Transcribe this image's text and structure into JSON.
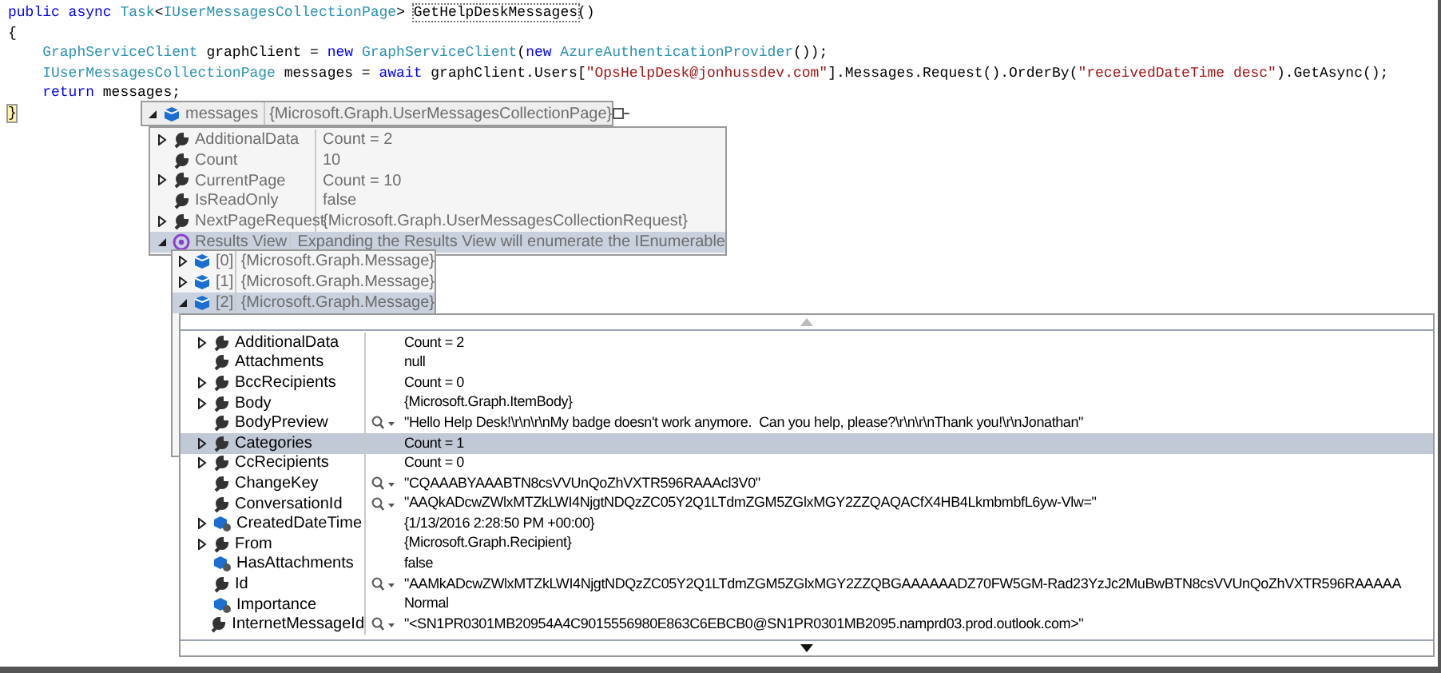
{
  "code_lines": [
    {
      "indented": false,
      "tokens": [
        {
          "text": "public async ",
          "kind": "keyword"
        },
        {
          "text": "Task",
          "kind": "type"
        },
        {
          "text": "<",
          "kind": "plain"
        },
        {
          "text": "IUserMessagesCollectionPage",
          "kind": "type"
        },
        {
          "text": "> ",
          "kind": "plain"
        },
        {
          "text": "GetHelpDeskMessages",
          "kind": "highlight"
        },
        {
          "text": "()",
          "kind": "plain"
        }
      ]
    },
    {
      "indented": false,
      "tokens": [
        {
          "text": "{",
          "kind": "plain"
        }
      ]
    },
    {
      "indented": true,
      "tokens": [
        {
          "text": "GraphServiceClient",
          "kind": "type"
        },
        {
          "text": " graphClient = ",
          "kind": "plain"
        },
        {
          "text": "new ",
          "kind": "keyword"
        },
        {
          "text": "GraphServiceClient",
          "kind": "type"
        },
        {
          "text": "(",
          "kind": "plain"
        },
        {
          "text": "new ",
          "kind": "keyword"
        },
        {
          "text": "AzureAuthenticationProvider",
          "kind": "type"
        },
        {
          "text": "());",
          "kind": "plain"
        }
      ]
    },
    {
      "indented": true,
      "tokens": [
        {
          "text": "IUserMessagesCollectionPage",
          "kind": "type"
        },
        {
          "text": " messages = ",
          "kind": "plain"
        },
        {
          "text": "await ",
          "kind": "keyword"
        },
        {
          "text": "graphClient.Users[",
          "kind": "plain"
        },
        {
          "text": "\"OpsHelpDesk@jonhussdev.com\"",
          "kind": "string"
        },
        {
          "text": "].Messages.Request().OrderBy(",
          "kind": "plain"
        },
        {
          "text": "\"receivedDateTime desc\"",
          "kind": "string"
        },
        {
          "text": ").GetAsync();",
          "kind": "plain"
        }
      ]
    },
    {
      "indented": true,
      "tokens": [
        {
          "text": "return ",
          "kind": "keyword"
        },
        {
          "text": "messages;",
          "kind": "plain"
        }
      ]
    },
    {
      "indented": false,
      "tokens": [
        {
          "text": "}",
          "kind": "brace"
        }
      ]
    }
  ],
  "datatip": {
    "name": "messages",
    "value": "{Microsoft.Graph.UserMessagesCollectionPage}",
    "expanded": true
  },
  "members": [
    {
      "name": "AdditionalData",
      "value": "Count = 2",
      "kind": "property",
      "expandable": true,
      "expanded": false,
      "selected": false
    },
    {
      "name": "Count",
      "value": "10",
      "kind": "property",
      "expandable": false,
      "selected": false
    },
    {
      "name": "CurrentPage",
      "value": "Count = 10",
      "kind": "property",
      "expandable": true,
      "expanded": false,
      "selected": false
    },
    {
      "name": "IsReadOnly",
      "value": "false",
      "kind": "property",
      "expandable": false,
      "selected": false
    },
    {
      "name": "NextPageRequest",
      "value": "{Microsoft.Graph.UserMessagesCollectionRequest}",
      "kind": "property",
      "expandable": true,
      "expanded": false,
      "selected": false
    },
    {
      "name": "Results View",
      "value": "Expanding the Results View will enumerate the IEnumerable",
      "kind": "results",
      "expandable": true,
      "expanded": true,
      "selected": true
    }
  ],
  "results": [
    {
      "name": "[0]",
      "value": "{Microsoft.Graph.Message}",
      "expanded": false,
      "selected": false
    },
    {
      "name": "[1]",
      "value": "{Microsoft.Graph.Message}",
      "expanded": false,
      "selected": false
    },
    {
      "name": "[2]",
      "value": "{Microsoft.Graph.Message}",
      "expanded": true,
      "selected": true
    }
  ],
  "details": [
    {
      "name": "AdditionalData",
      "value": "Count = 2",
      "kind": "property",
      "expandable": true,
      "visualizer": false,
      "selected": false
    },
    {
      "name": "Attachments",
      "value": "null",
      "kind": "property",
      "expandable": false,
      "visualizer": false,
      "selected": false
    },
    {
      "name": "BccRecipients",
      "value": "Count = 0",
      "kind": "property",
      "expandable": true,
      "visualizer": false,
      "selected": false
    },
    {
      "name": "Body",
      "value": "{Microsoft.Graph.ItemBody}",
      "kind": "property",
      "expandable": true,
      "visualizer": false,
      "selected": false
    },
    {
      "name": "BodyPreview",
      "value": "\"Hello Help Desk!\\r\\n\\r\\nMy badge doesn't work anymore.  Can you help, please?\\r\\n\\r\\nThank you!\\r\\nJonathan\"",
      "kind": "property",
      "expandable": false,
      "visualizer": true,
      "selected": false
    },
    {
      "name": "Categories",
      "value": "Count = 1",
      "kind": "property",
      "expandable": true,
      "visualizer": false,
      "selected": true
    },
    {
      "name": "CcRecipients",
      "value": "Count = 0",
      "kind": "property",
      "expandable": true,
      "visualizer": false,
      "selected": false
    },
    {
      "name": "ChangeKey",
      "value": "\"CQAAABYAAABTN8csVVUnQoZhVXTR596RAAAcl3V0\"",
      "kind": "property",
      "expandable": false,
      "visualizer": true,
      "selected": false
    },
    {
      "name": "ConversationId",
      "value": "\"AAQkADcwZWlxMTZkLWI4NjgtNDQzZC05Y2Q1LTdmZGM5ZGlxMGY2ZZQAQACfX4HB4LkmbmbfL6yw-Vlw=\"",
      "kind": "property",
      "expandable": false,
      "visualizer": true,
      "selected": false
    },
    {
      "name": "CreatedDateTime",
      "value": "{1/13/2016 2:28:50 PM +00:00}",
      "kind": "field",
      "expandable": true,
      "visualizer": false,
      "selected": false
    },
    {
      "name": "From",
      "value": "{Microsoft.Graph.Recipient}",
      "kind": "property",
      "expandable": true,
      "visualizer": false,
      "selected": false
    },
    {
      "name": "HasAttachments",
      "value": "false",
      "kind": "field",
      "expandable": false,
      "visualizer": false,
      "selected": false
    },
    {
      "name": "Id",
      "value": "\"AAMkADcwZWlxMTZkLWI4NjgtNDQzZC05Y2Q1LTdmZGM5ZGlxMGY2ZZQBGAAAAAADZ70FW5GM-Rad23YzJc2MuBwBTN8csVVUnQoZhVXTR596RAAAAA",
      "kind": "property",
      "expandable": false,
      "visualizer": true,
      "selected": false
    },
    {
      "name": "Importance",
      "value": "Normal",
      "kind": "field",
      "expandable": false,
      "visualizer": false,
      "selected": false
    },
    {
      "name": "InternetMessageId",
      "value": "\"<SN1PR0301MB20954A4C9015556980E863C6EBCB0@SN1PR0301MB2095.namprd03.prod.outlook.com>\"",
      "kind": "property",
      "expandable": false,
      "visualizer": true,
      "selected": false
    }
  ]
}
